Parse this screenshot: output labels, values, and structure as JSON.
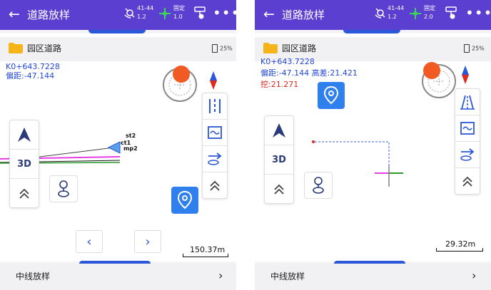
{
  "colors": {
    "header": "#5b3fd0",
    "accent": "#2b58d8",
    "info_blue": "#2348d8",
    "fill_red": "#e0281c",
    "compass_dot": "#f15a22",
    "locate_button": "#2f80ed"
  },
  "left": {
    "header": {
      "title": "道路放样",
      "back_icon": "back-arrow-icon",
      "sat": {
        "count": "41-44",
        "value": "1.2"
      },
      "fix": {
        "label": "固定",
        "value": "1.0"
      },
      "more": "•••"
    },
    "folder": {
      "name": "园区道路",
      "battery": "25%"
    },
    "info": {
      "mileage": "K0+643.7228",
      "offset": "偏距:-47.144"
    },
    "map_labels": {
      "a": "st2",
      "b": "ct1",
      "c": "mp2"
    },
    "left_tools": {
      "3d": "3D"
    },
    "nav": {
      "prev": "‹",
      "next": "›"
    },
    "scale": "150.37m",
    "bottom": {
      "label": "中线放样",
      "chevron": "›"
    }
  },
  "right": {
    "header": {
      "title": "道路放样",
      "sat": {
        "count": "41-44",
        "value": "1.2"
      },
      "fix": {
        "label": "固定",
        "value": "2.0"
      },
      "more": "•••"
    },
    "folder": {
      "name": "园区道路",
      "battery": "25%"
    },
    "info": {
      "mileage": "K0+643.7228",
      "offset_height": "偏距:-47.144 高差:21.421",
      "fill": "挖:21.271"
    },
    "left_tools": {
      "3d": "3D"
    },
    "scale": "29.32m",
    "bottom": {
      "label": "中线放样",
      "chevron": "›"
    }
  }
}
